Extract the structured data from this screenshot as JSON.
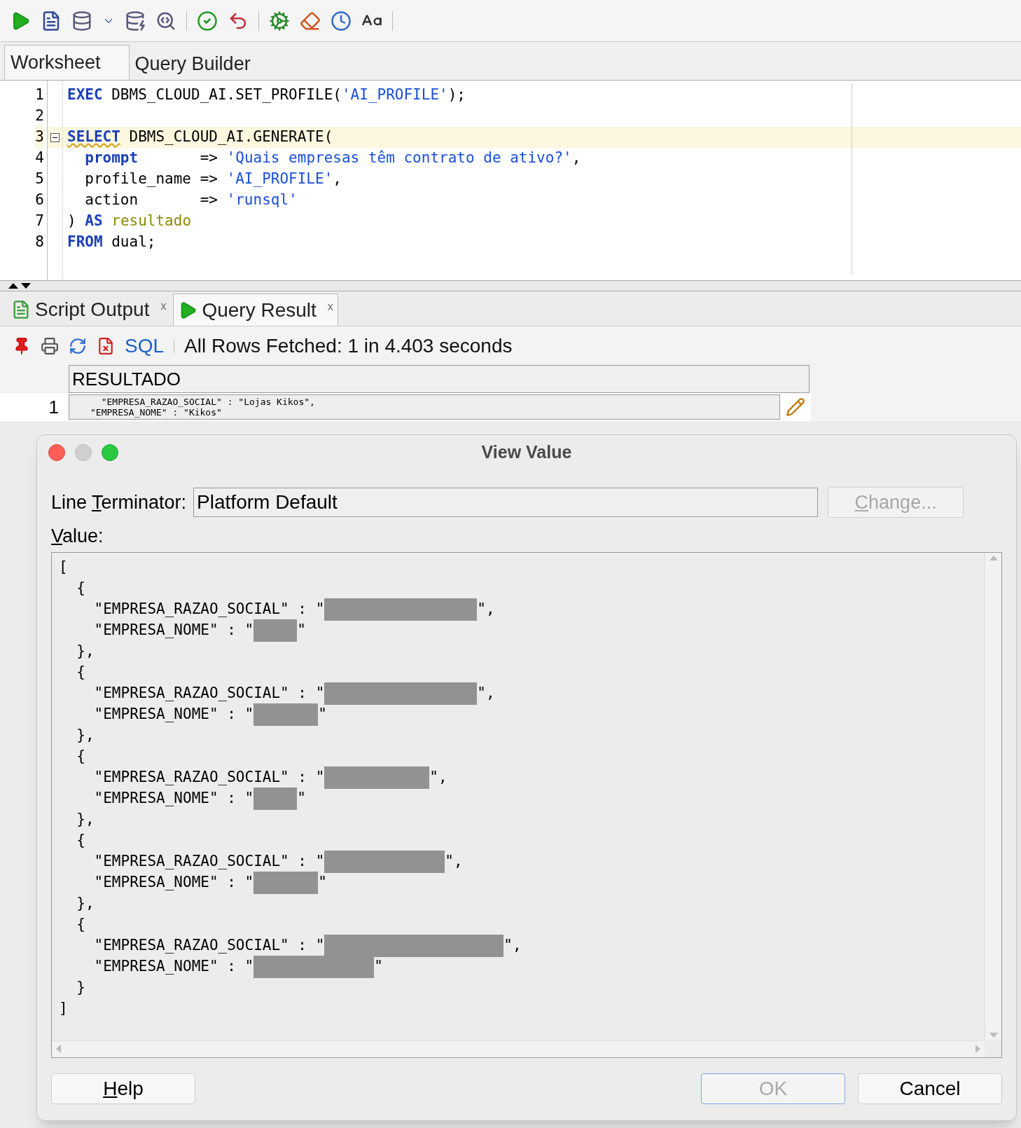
{
  "editor_tabs": [
    {
      "label": "Worksheet",
      "selected": true
    },
    {
      "label": "Query Builder",
      "selected": false
    }
  ],
  "editor": {
    "lines": [
      {
        "number": "1",
        "current": false,
        "fold": false,
        "tokens": [
          {
            "kind": "keyword",
            "text": "EXEC"
          },
          {
            "kind": "plain",
            "text": " DBMS_CLOUD_AI.SET_PROFILE("
          },
          {
            "kind": "string",
            "text": "'AI_PROFILE'"
          },
          {
            "kind": "plain",
            "text": ");"
          }
        ]
      },
      {
        "number": "2",
        "current": false,
        "fold": false
      },
      {
        "number": "3",
        "current": true,
        "fold": true,
        "tokens": [
          {
            "kind": "flagged_keyword",
            "text": "SELECT"
          },
          {
            "kind": "plain",
            "text": " DBMS_CLOUD_AI.GENERATE("
          }
        ]
      },
      {
        "number": "4",
        "current": false,
        "fold": false,
        "tokens": [
          {
            "kind": "keyword",
            "text": "  prompt"
          },
          {
            "kind": "plain",
            "text": "       => "
          },
          {
            "kind": "string",
            "text": "'Quais empresas têm contrato de ativo?'"
          },
          {
            "kind": "plain",
            "text": ","
          }
        ]
      },
      {
        "number": "5",
        "current": false,
        "fold": false,
        "tokens": [
          {
            "kind": "plain",
            "text": "  profile_name => "
          },
          {
            "kind": "string",
            "text": "'AI_PROFILE'"
          },
          {
            "kind": "plain",
            "text": ","
          }
        ]
      },
      {
        "number": "6",
        "current": false,
        "fold": false,
        "tokens": [
          {
            "kind": "plain",
            "text": "  action       => "
          },
          {
            "kind": "string",
            "text": "'runsql'"
          }
        ]
      },
      {
        "number": "7",
        "current": false,
        "fold": false,
        "tokens": [
          {
            "kind": "plain",
            "text": ") "
          },
          {
            "kind": "keyword",
            "text": "AS"
          },
          {
            "kind": "alias",
            "text": " resultado"
          }
        ]
      },
      {
        "number": "8",
        "current": false,
        "fold": false,
        "tokens": [
          {
            "kind": "keyword",
            "text": "FROM"
          },
          {
            "kind": "plain",
            "text": " dual;"
          }
        ]
      }
    ]
  },
  "result_tabs": [
    {
      "label": "Script Output",
      "close": "x",
      "selected": false
    },
    {
      "label": "Query Result",
      "close": "x",
      "selected": true
    }
  ],
  "result_toolbar": {
    "sql_link": "SQL",
    "status": "All Rows Fetched: 1 in 4.403 seconds"
  },
  "grid": {
    "columns": [
      "RESULTADO"
    ],
    "rows": [
      {
        "number": "1",
        "lines": [
          "  \"EMPRESA_RAZAO_SOCIAL\" : \"Lojas Kikos\",",
          "\"EMPRESA_NOME\" : \"Kikos\""
        ]
      }
    ]
  },
  "dialog": {
    "title": "View Value",
    "line_terminator": {
      "label_before": "Line ",
      "mnemonic": "T",
      "label_after": "erminator:",
      "value": "Platform Default"
    },
    "change_button": {
      "mnemonic": "C",
      "label_after": "hange...",
      "disabled": true
    },
    "value_label": {
      "mnemonic": "V",
      "label_after": "alue:"
    },
    "value_lines": [
      {
        "kind": "text",
        "text": "["
      },
      {
        "kind": "text",
        "text": "  {"
      },
      {
        "kind": "redacted",
        "before": "    \"EMPRESA_RAZAO_SOCIAL\" : \"",
        "after": "\","
      },
      {
        "kind": "redacted",
        "before": "    \"EMPRESA_NOME\" : \"",
        "after": "\""
      },
      {
        "kind": "text",
        "text": "  },"
      },
      {
        "kind": "text",
        "text": "  {"
      },
      {
        "kind": "redacted",
        "before": "    \"EMPRESA_RAZAO_SOCIAL\" : \"",
        "after": "\","
      },
      {
        "kind": "redacted",
        "before": "    \"EMPRESA_NOME\" : \"",
        "after": "\""
      },
      {
        "kind": "text",
        "text": "  },"
      },
      {
        "kind": "text",
        "text": "  {"
      },
      {
        "kind": "redacted",
        "before": "    \"EMPRESA_RAZAO_SOCIAL\" : \"",
        "after": "\","
      },
      {
        "kind": "redacted",
        "before": "    \"EMPRESA_NOME\" : \"",
        "after": "\""
      },
      {
        "kind": "text",
        "text": "  },"
      },
      {
        "kind": "text",
        "text": "  {"
      },
      {
        "kind": "redacted",
        "before": "    \"EMPRESA_RAZAO_SOCIAL\" : \"",
        "after": "\","
      },
      {
        "kind": "redacted",
        "before": "    \"EMPRESA_NOME\" : \"",
        "after": "\""
      },
      {
        "kind": "text",
        "text": "  },"
      },
      {
        "kind": "text",
        "text": "  {"
      },
      {
        "kind": "redacted",
        "before": "    \"EMPRESA_RAZAO_SOCIAL\" : \"",
        "after": "\","
      },
      {
        "kind": "redacted",
        "before": "    \"EMPRESA_NOME\" : \"",
        "after": "\""
      },
      {
        "kind": "text",
        "text": "  }"
      },
      {
        "kind": "text",
        "text": "]"
      }
    ],
    "buttons": [
      {
        "kind": "help",
        "mnemonic": "H",
        "label_after": "elp",
        "disabled": false
      },
      {
        "kind": "ok",
        "label": "OK",
        "disabled": true
      },
      {
        "kind": "cancel",
        "label": "Cancel",
        "disabled": false
      }
    ]
  }
}
